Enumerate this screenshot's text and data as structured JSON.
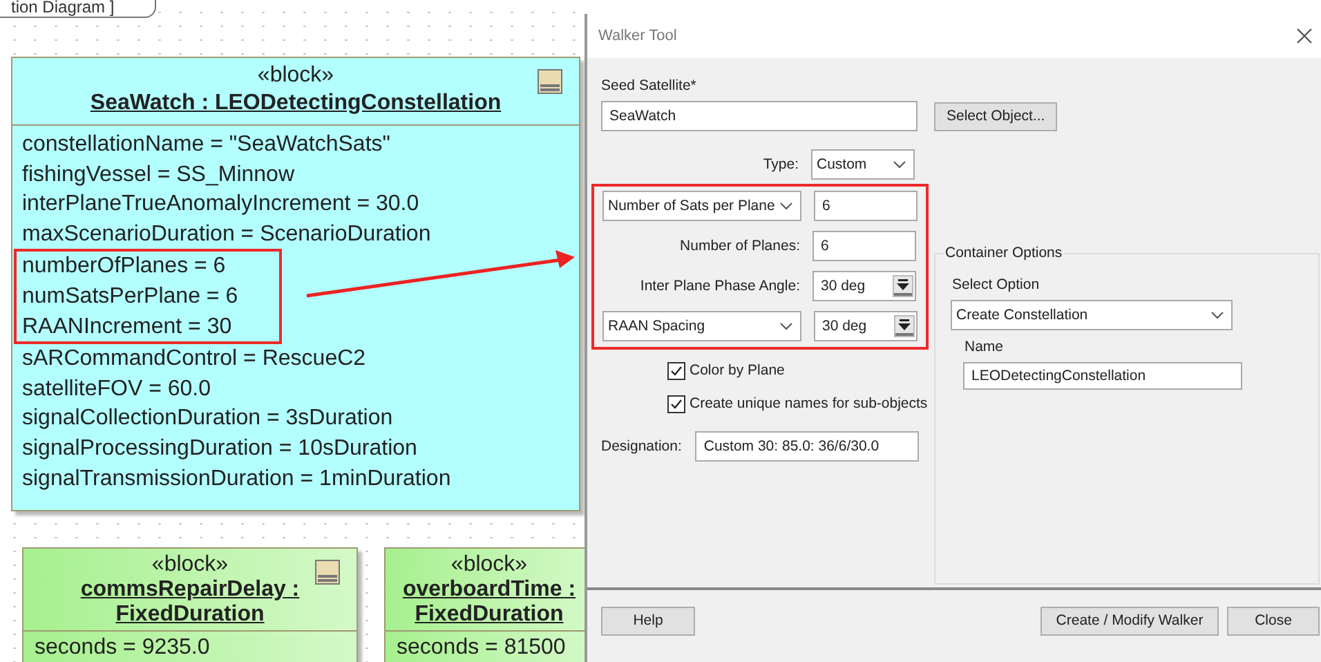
{
  "diagram": {
    "frame_tab": "tion Diagram ]",
    "blocks": [
      {
        "kind": "instance",
        "stereotype": "«block»",
        "name_lines": [
          "SeaWatch : LEODetectingConstellation"
        ],
        "attributes": [
          {
            "text": "constellationName = \"SeaWatchSats\"",
            "highlighted": false
          },
          {
            "text": "fishingVessel = SS_Minnow",
            "highlighted": false
          },
          {
            "text": "interPlaneTrueAnomalyIncrement = 30.0",
            "highlighted": false
          },
          {
            "text": "maxScenarioDuration = ScenarioDuration",
            "highlighted": false
          },
          {
            "text": "numberOfPlanes = 6",
            "highlighted": true
          },
          {
            "text": "numSatsPerPlane = 6",
            "highlighted": true
          },
          {
            "text": "RAANIncrement = 30",
            "highlighted": true
          },
          {
            "text": "sARCommandControl = RescueC2",
            "highlighted": false
          },
          {
            "text": "satelliteFOV = 60.0",
            "highlighted": false
          },
          {
            "text": "signalCollectionDuration = 3sDuration",
            "highlighted": false
          },
          {
            "text": "signalProcessingDuration = 10sDuration",
            "highlighted": false
          },
          {
            "text": "signalTransmissionDuration = 1minDuration",
            "highlighted": false
          }
        ]
      },
      {
        "kind": "value",
        "stereotype": "«block»",
        "name_lines": [
          "commsRepairDelay :",
          "FixedDuration"
        ],
        "attributes": [
          {
            "text": "seconds = 9235.0",
            "highlighted": false
          }
        ]
      },
      {
        "kind": "value",
        "stereotype": "«block»",
        "name_lines": [
          "overboardTime :",
          "FixedDuration"
        ],
        "attributes": [
          {
            "text": "seconds = 81500",
            "highlighted": false
          }
        ]
      }
    ]
  },
  "dialog": {
    "title": "Walker Tool",
    "seed_label": "Seed Satellite*",
    "seed_value": "SeaWatch",
    "select_object_button": "Select Object...",
    "type_label": "Type:",
    "type_value": "Custom",
    "parameters": {
      "highlighted": true,
      "rows": [
        {
          "kind": "select",
          "label": "Number of Sats per Plane",
          "value": "6",
          "spinner": false
        },
        {
          "kind": "label",
          "label": "Number of Planes:",
          "value": "6",
          "spinner": false
        },
        {
          "kind": "label",
          "label": "Inter Plane Phase Angle:",
          "value": "30 deg",
          "spinner": true
        },
        {
          "kind": "select",
          "label": "RAAN Spacing",
          "value": "30 deg",
          "spinner": true
        }
      ]
    },
    "checkboxes": [
      {
        "label": "Color by Plane",
        "checked": true
      },
      {
        "label": "Create unique names for sub-objects",
        "checked": true
      }
    ],
    "designation_label": "Designation:",
    "designation_value": "Custom 30: 85.0: 36/6/30.0",
    "container": {
      "legend": "Container Options",
      "option_label": "Select Option",
      "option_value": "Create Constellation",
      "name_label": "Name",
      "name_value": "LEODetectingConstellation"
    },
    "buttons": {
      "help": "Help",
      "create": "Create / Modify Walker",
      "close": "Close"
    }
  }
}
